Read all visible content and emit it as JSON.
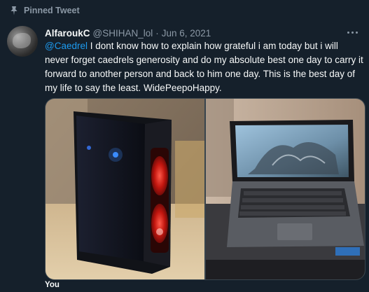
{
  "pinned": {
    "label": "Pinned Tweet",
    "icon": "pin-icon"
  },
  "tweet": {
    "display_name": "AlfaroukC",
    "handle": "@SHIHAN_lol",
    "separator": "·",
    "date": "Jun 6, 2021",
    "mention": "@Caedrel",
    "text": " I dont know how to explain how grateful i am today but i will never forget caedrels generosity and do my absolute best one day to carry it forward to another person and back to him one day. This is the best day of my life to say the least. WidePeepoHappy."
  },
  "footer": {
    "label": "You"
  },
  "colors": {
    "background": "#15202b",
    "text": "#f7f9f9",
    "secondary": "#8b98a5",
    "accent": "#1d9bf0",
    "border": "#38444d"
  }
}
